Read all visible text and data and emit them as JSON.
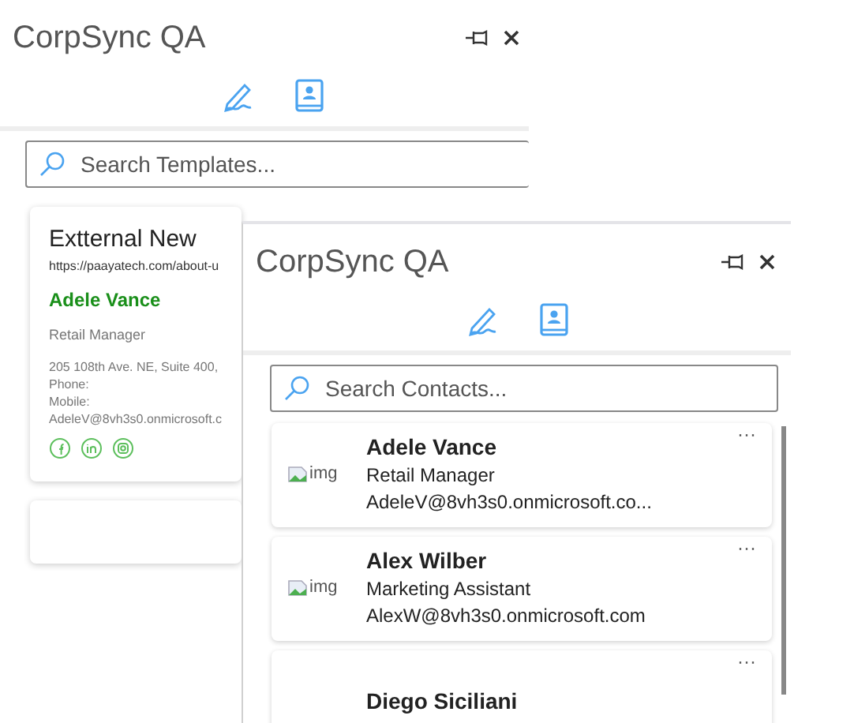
{
  "templates_panel": {
    "title": "CorpSync QA",
    "search": {
      "placeholder": "Search Templates..."
    },
    "templates": [
      {
        "title": "Extternal New",
        "url": "https://paayatech.com/about-u",
        "name": "Adele Vance",
        "role": "Retail Manager",
        "lines": [
          "205 108th Ave. NE, Suite 400,",
          "Phone:",
          "Mobile:",
          "AdeleV@8vh3s0.onmicrosoft.c"
        ]
      }
    ]
  },
  "contacts_panel": {
    "title": "CorpSync QA",
    "search": {
      "placeholder": "Search Contacts..."
    },
    "contacts": [
      {
        "name": "Adele Vance",
        "job": "Retail Manager",
        "email": "AdeleV@8vh3s0.onmicrosoft.co...",
        "image_alt": "img",
        "more": "···"
      },
      {
        "name": "Alex Wilber",
        "job": "Marketing Assistant",
        "email": "AlexW@8vh3s0.onmicrosoft.com",
        "image_alt": "img",
        "more": "···"
      },
      {
        "name": "Diego Siciliani",
        "more": "···"
      }
    ]
  }
}
